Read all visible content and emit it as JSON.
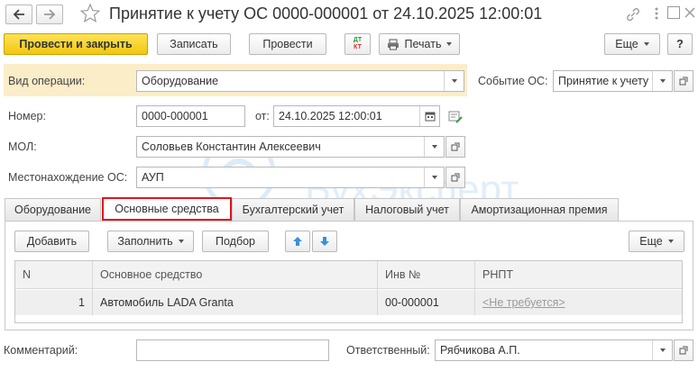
{
  "window": {
    "title": "Принятие к учету ОС 0000-000001 от 24.10.2025 12:00:01"
  },
  "toolbar": {
    "post_and_close": "Провести и закрыть",
    "save": "Записать",
    "post": "Провести",
    "dt_kt_top": "ДТ",
    "dt_kt_bottom": "КТ",
    "print": "Печать",
    "more": "Еще",
    "help": "?"
  },
  "header": {
    "operation_label": "Вид операции:",
    "operation_value": "Оборудование",
    "event_label": "Событие ОС:",
    "event_value": "Принятие к учету"
  },
  "form": {
    "number_label": "Номер:",
    "number_value": "0000-000001",
    "date_label": "от:",
    "date_value": "24.10.2025 12:00:01",
    "mol_label": "МОЛ:",
    "mol_value": "Соловьев Константин Алексеевич",
    "location_label": "Местонахождение ОС:",
    "location_value": "АУП"
  },
  "watermark": "БухЭксперт",
  "tabs": [
    {
      "label": "Оборудование"
    },
    {
      "label": "Основные средства"
    },
    {
      "label": "Бухгалтерский учет"
    },
    {
      "label": "Налоговый учет"
    },
    {
      "label": "Амортизационная премия"
    }
  ],
  "table_toolbar": {
    "add": "Добавить",
    "fill": "Заполнить",
    "pick": "Подбор",
    "more": "Еще"
  },
  "table": {
    "columns": [
      "N",
      "Основное средство",
      "Инв №",
      "РНПТ"
    ],
    "rows": [
      {
        "n": "1",
        "asset": "Автомобиль LADA Granta",
        "inv": "00-000001",
        "rnpt": "<Не требуется>"
      }
    ]
  },
  "footer": {
    "comment_label": "Комментарий:",
    "comment_value": "",
    "responsible_label": "Ответственный:",
    "responsible_value": "Рябчикова А.П."
  },
  "colors": {
    "primary_button": "#f6cd1c",
    "header_panel": "#fbedc8",
    "active_tab_border": "#e0161b",
    "arrow_blue": "#3b8fd9",
    "link_gray": "#9a9a9a"
  }
}
